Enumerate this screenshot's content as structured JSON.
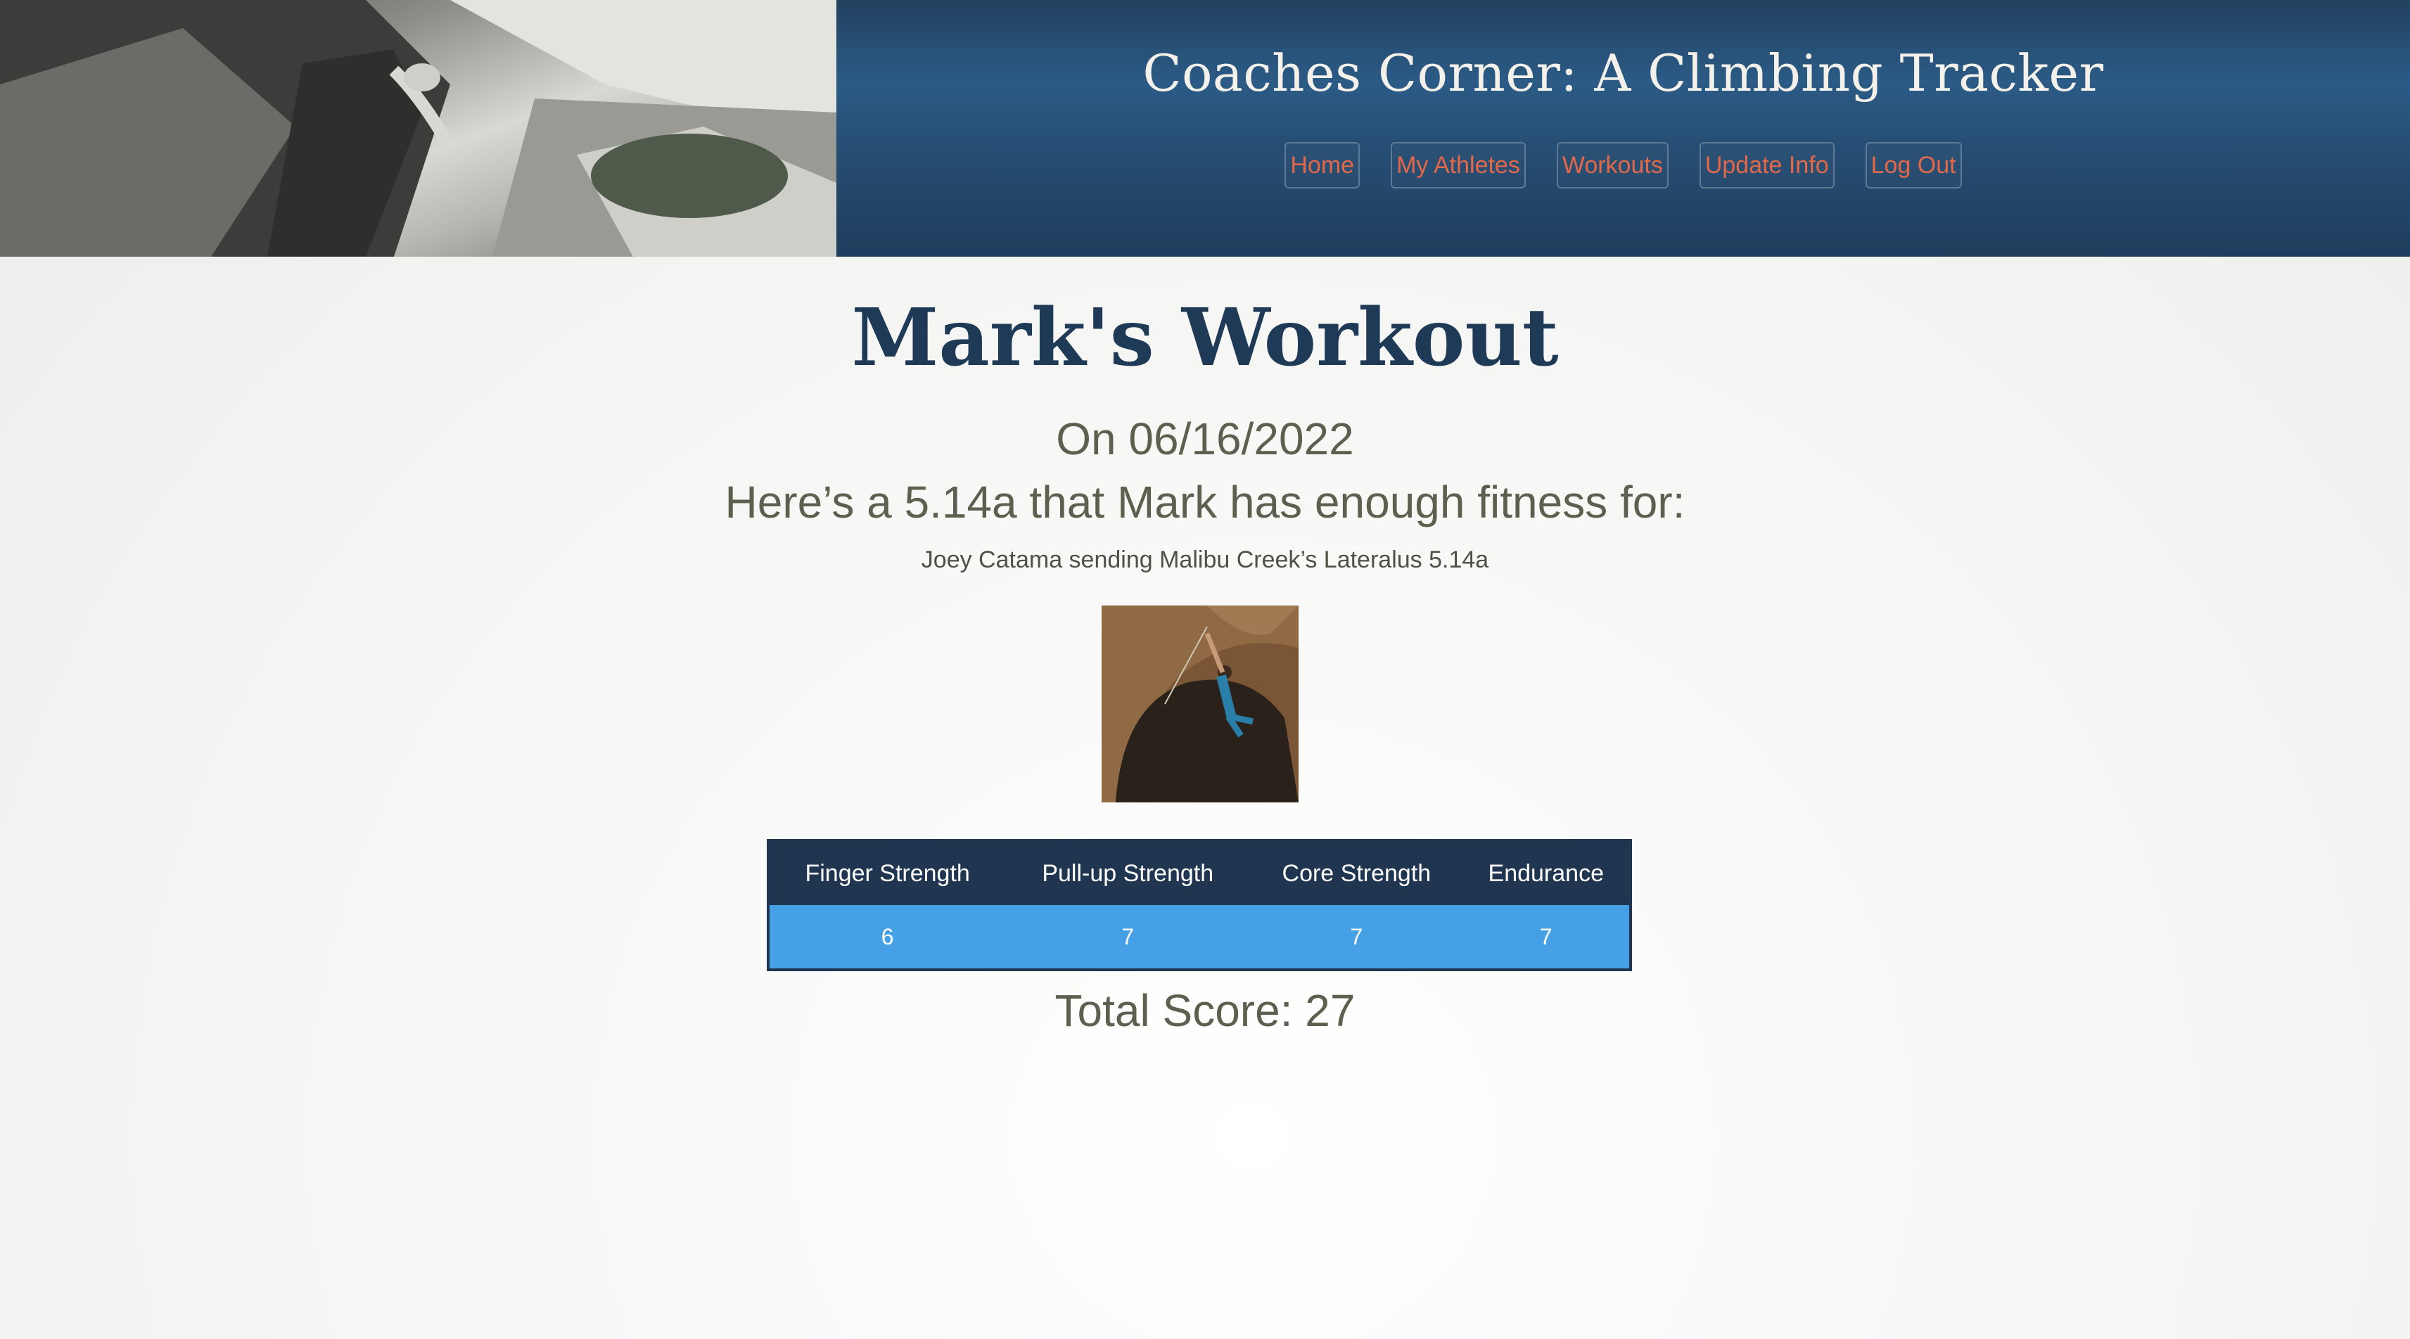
{
  "header": {
    "site_title": "Coaches Corner: A Climbing Tracker",
    "nav": [
      {
        "label": "Home"
      },
      {
        "label": "My Athletes"
      },
      {
        "label": "Workouts"
      },
      {
        "label": "Update Info"
      },
      {
        "label": "Log Out"
      }
    ]
  },
  "main": {
    "title": "Mark's Workout",
    "date_line": "On 06/16/2022",
    "fitness_line": "Here’s a 5.14a that Mark has enough fitness for:",
    "photo_caption": "Joey Catama sending Malibu Creek’s Lateralus 5.14a",
    "scores_table": {
      "headers": [
        "Finger Strength",
        "Pull-up Strength",
        "Core Strength",
        "Endurance"
      ],
      "values": [
        "6",
        "7",
        "7",
        "7"
      ]
    },
    "total_score": "Total Score: 27"
  },
  "colors": {
    "banner_blue": "#2b5b86",
    "nav_link": "#e3684a",
    "table_header": "#1f3550",
    "table_row": "#46a0e6",
    "title_text": "#1f3a57",
    "body_text": "#5e604f"
  }
}
